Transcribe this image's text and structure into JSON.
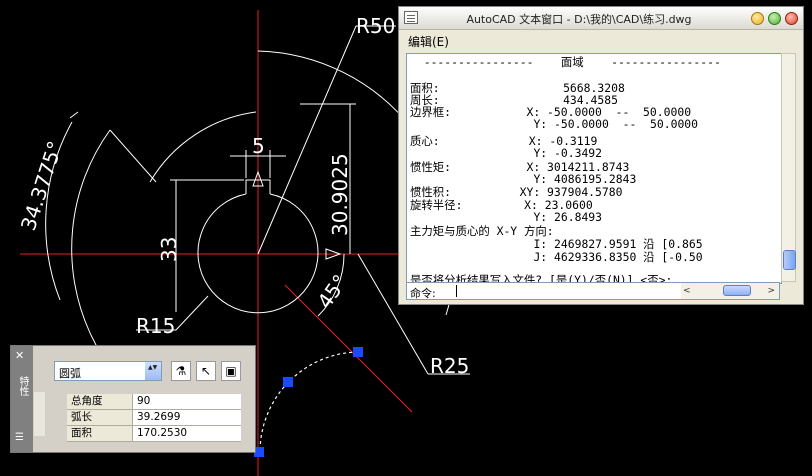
{
  "drawing": {
    "dim_r50": "R50",
    "dim_5": "5",
    "dim_30_9025": "30.9025",
    "dim_33": "33",
    "dim_34_3775": "34.3775°",
    "dim_45": "45°",
    "dim_r15": "R15",
    "dim_r25": "R25"
  },
  "text_window": {
    "title": "AutoCAD 文本窗口 - D:\\我的\\CAD\\练习.dwg",
    "menu_edit": "编辑(E)",
    "lines": [
      "  ----------------    面域    ----------------",
      "面积:                  5668.3208",
      "周长:                  434.4585",
      "边界框:           X: -50.0000  --  50.0000",
      "                  Y: -50.0000  --  50.0000",
      "质心:             X: -0.3119",
      "                  Y: -0.3492",
      "惯性矩:           X: 3014211.8743",
      "                  Y: 4086195.2843",
      "惯性积:          XY: 937904.5780",
      "旋转半径:         X: 23.0600",
      "                  Y: 26.8493",
      "主力矩与质心的 X-Y 方向:",
      "                  I: 2469827.9591 沿 [0.865",
      "                  J: 4629336.8350 沿 [-0.50",
      "是否将分析结果写入文件? [是(Y)/否(N)] <否>:"
    ],
    "command_label": "命令:",
    "scroll_left": "<",
    "scroll_right": ">"
  },
  "properties": {
    "object_type": "圆弧",
    "rows": [
      {
        "key": "总角度",
        "value": "90"
      },
      {
        "key": "弧长",
        "value": "39.2699"
      },
      {
        "key": "面积",
        "value": "170.2530"
      }
    ],
    "bar_close": "✕",
    "bar_title": "特性"
  },
  "colors": {
    "background": "#000000",
    "centerline": "#e8202a",
    "grip": "#1a4cff",
    "window_face": "#ece9d8",
    "close_button": "#e04030",
    "min_button": "#e8b020",
    "max_button": "#4cb030"
  }
}
